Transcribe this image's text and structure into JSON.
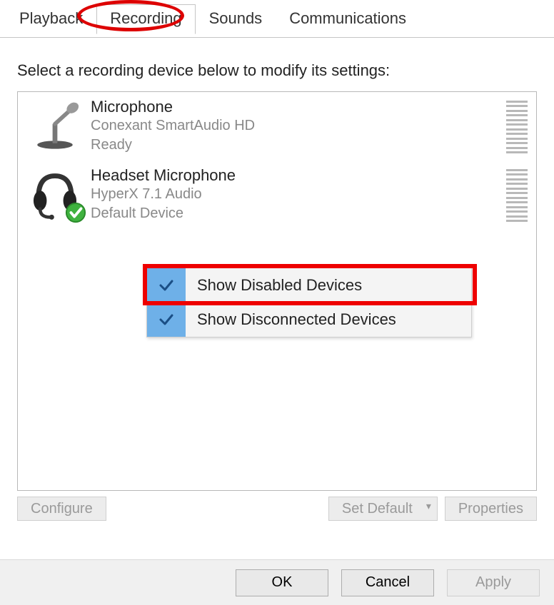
{
  "tabs": {
    "playback": "Playback",
    "recording": "Recording",
    "sounds": "Sounds",
    "communications": "Communications"
  },
  "instruction": "Select a recording device below to modify its settings:",
  "devices": [
    {
      "name": "Microphone",
      "driver": "Conexant SmartAudio HD",
      "status": "Ready",
      "default": false,
      "icon": "desk-mic-icon"
    },
    {
      "name": "Headset Microphone",
      "driver": "HyperX 7.1 Audio",
      "status": "Default Device",
      "default": true,
      "icon": "headset-icon"
    }
  ],
  "context_menu": {
    "show_disabled": "Show Disabled Devices",
    "show_disconnected": "Show Disconnected Devices"
  },
  "buttons": {
    "configure": "Configure",
    "set_default": "Set Default",
    "properties": "Properties",
    "ok": "OK",
    "cancel": "Cancel",
    "apply": "Apply"
  },
  "highlights": {
    "tab_ellipse_on": "recording",
    "context_box_on": "show_disabled"
  }
}
